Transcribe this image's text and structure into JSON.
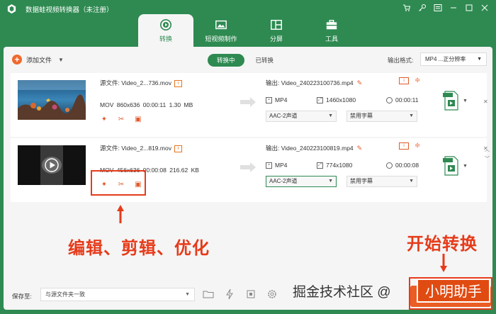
{
  "app": {
    "title": "数据蛙视频转换器（未注册）",
    "window_controls": [
      "cart-icon",
      "key-icon",
      "menu-icon",
      "minimize-icon",
      "maximize-icon",
      "close-icon"
    ]
  },
  "nav": {
    "tabs": [
      {
        "label": "转换",
        "icon": "convert-icon",
        "active": true
      },
      {
        "label": "短视频制作",
        "icon": "mv-icon",
        "active": false
      },
      {
        "label": "分屏",
        "icon": "collage-icon",
        "active": false
      },
      {
        "label": "工具",
        "icon": "toolbox-icon",
        "active": false
      }
    ]
  },
  "toolbar": {
    "add_label": "添加文件",
    "seg_active": "转换中",
    "seg_inactive": "已转换",
    "format_label": "输出格式:",
    "format_value": "MP4 ...正分辨率"
  },
  "files": [
    {
      "source_name": "源文件: Video_2...736.mov",
      "format": "MOV",
      "resolution": "860x636",
      "duration": "00:00:11",
      "size": "1.30 MB",
      "output_name": "输出: Video_240223100736.mp4",
      "out_format": "MP4",
      "out_resolution": "1460x1080",
      "out_duration": "00:00:11",
      "audio": "AAC-2声道",
      "subtitle": "禁用字幕"
    },
    {
      "source_name": "源文件: Video_2...819.mov",
      "format": "MOV",
      "resolution": "456x636",
      "duration": "00:00:08",
      "size": "216.62 KB",
      "output_name": "输出: Video_240223100819.mp4",
      "out_format": "MP4",
      "out_resolution": "774x1080",
      "out_duration": "00:00:08",
      "audio": "AAC-2声道",
      "subtitle": "禁用字幕"
    }
  ],
  "bottom": {
    "save_label": "保存至:",
    "save_value": "与源文件夹一致"
  },
  "annotations": {
    "edit_tools": "编辑、剪辑、优化",
    "start_convert": "开始转换"
  },
  "watermark": {
    "text": "掘金技术社区 @",
    "brand": "小明助手"
  },
  "colors": {
    "brand_green": "#2e8a51",
    "accent_orange": "#ea5d24",
    "annotation_red": "#e63b1a"
  }
}
